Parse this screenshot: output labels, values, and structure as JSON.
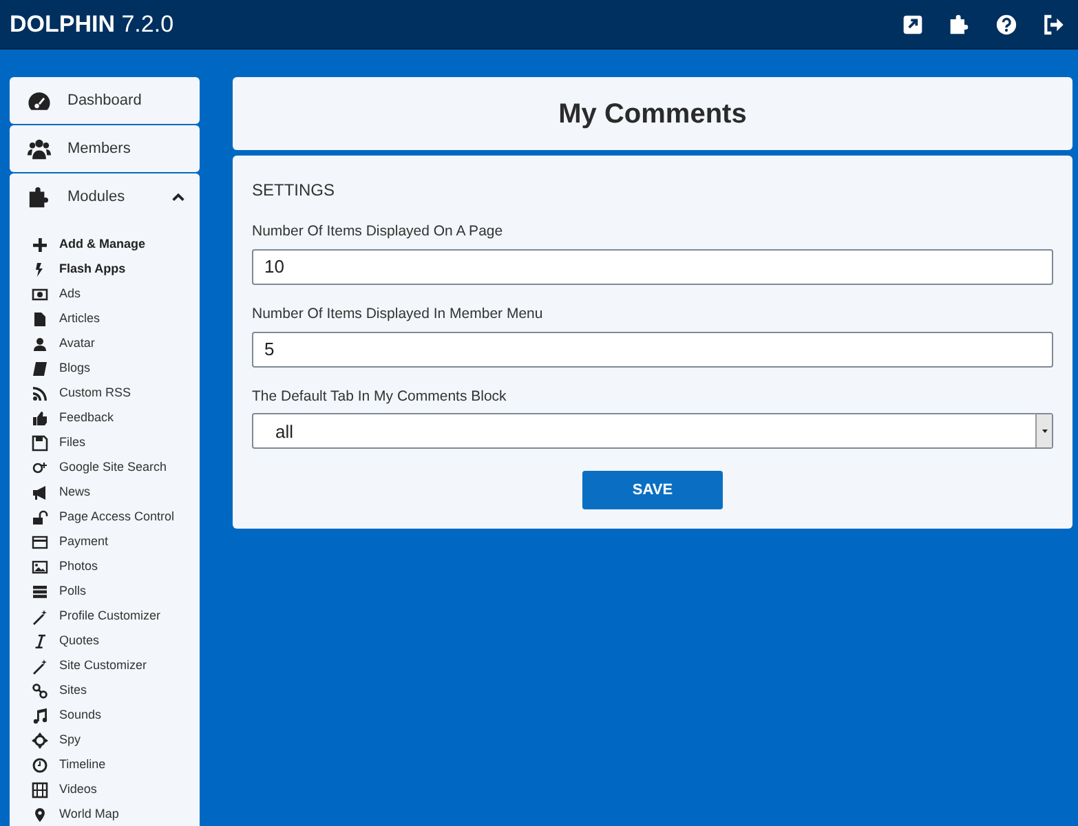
{
  "header": {
    "brand": "DOLPHIN",
    "version": "7.2.0"
  },
  "sidebar": {
    "sections": [
      {
        "label": "Dashboard"
      },
      {
        "label": "Members"
      },
      {
        "label": "Modules",
        "expanded": true
      }
    ],
    "items": [
      {
        "label": "Add & Manage",
        "kind": "action"
      },
      {
        "label": "Flash Apps",
        "kind": "action"
      },
      {
        "label": "Ads",
        "kind": "module"
      },
      {
        "label": "Articles",
        "kind": "module"
      },
      {
        "label": "Avatar",
        "kind": "module"
      },
      {
        "label": "Blogs",
        "kind": "module"
      },
      {
        "label": "Custom RSS",
        "kind": "module"
      },
      {
        "label": "Feedback",
        "kind": "module"
      },
      {
        "label": "Files",
        "kind": "module"
      },
      {
        "label": "Google Site Search",
        "kind": "module"
      },
      {
        "label": "News",
        "kind": "module"
      },
      {
        "label": "Page Access Control",
        "kind": "module"
      },
      {
        "label": "Payment",
        "kind": "module"
      },
      {
        "label": "Photos",
        "kind": "module"
      },
      {
        "label": "Polls",
        "kind": "module"
      },
      {
        "label": "Profile Customizer",
        "kind": "module"
      },
      {
        "label": "Quotes",
        "kind": "module"
      },
      {
        "label": "Site Customizer",
        "kind": "module"
      },
      {
        "label": "Sites",
        "kind": "module"
      },
      {
        "label": "Sounds",
        "kind": "module"
      },
      {
        "label": "Spy",
        "kind": "module"
      },
      {
        "label": "Timeline",
        "kind": "module"
      },
      {
        "label": "Videos",
        "kind": "module"
      },
      {
        "label": "World Map",
        "kind": "module"
      }
    ]
  },
  "page_title": "My Comments",
  "settings": {
    "heading": "SETTINGS",
    "fields": [
      {
        "label": "Number Of Items Displayed On A Page",
        "kind": "text",
        "value": "10"
      },
      {
        "label": "Number Of Items Displayed In Member Menu",
        "kind": "text",
        "value": "5"
      },
      {
        "label": "The Default Tab In My Comments Block",
        "kind": "select",
        "value": "all"
      }
    ],
    "button": "SAVE"
  }
}
